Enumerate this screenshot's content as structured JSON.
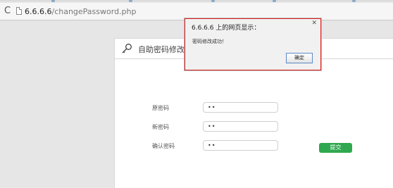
{
  "browser": {
    "url_host": "6.6.6.6",
    "url_path": "/changePassword.php",
    "reload_icon": "reload-icon",
    "page_icon": "document-icon"
  },
  "panel": {
    "title": "自助密码修改",
    "icon": "key-icon"
  },
  "form": {
    "fields": [
      {
        "label": "原密码",
        "value": "••"
      },
      {
        "label": "新密码",
        "value": "••"
      },
      {
        "label": "确认密码",
        "value": "••"
      }
    ],
    "submit_label": "提交"
  },
  "dialog": {
    "title": "6.6.6.6 上的网页显示：",
    "message": "密码修改成功！",
    "ok_label": "确定",
    "close_icon": "close-icon",
    "border_color": "#e01e1e"
  },
  "colors": {
    "submit": "#2fa84f",
    "dialog_ok_border": "#5b89c9"
  }
}
